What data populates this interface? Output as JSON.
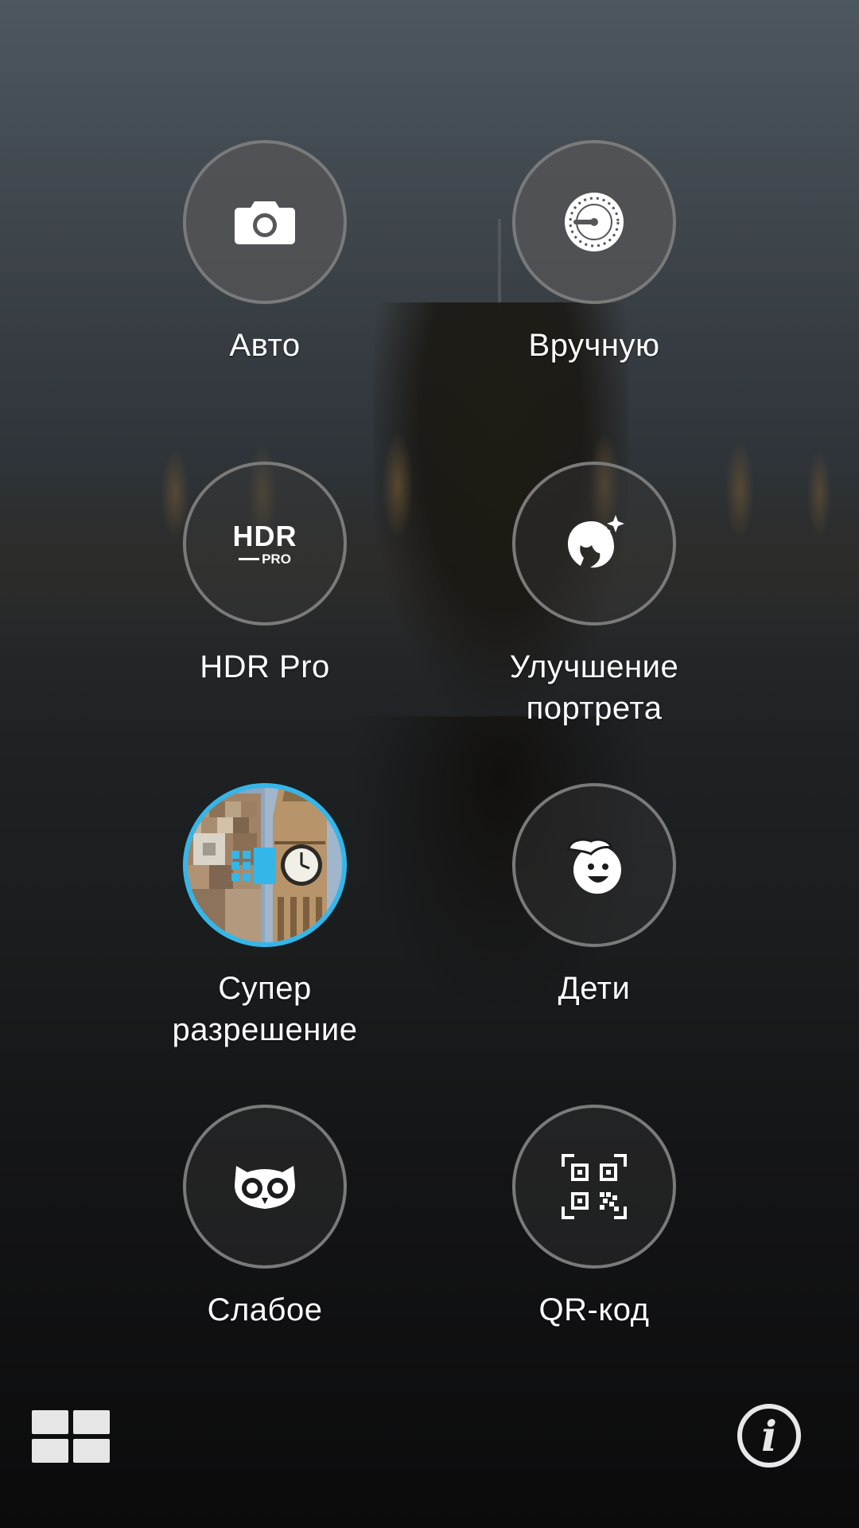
{
  "modes": [
    {
      "id": "auto",
      "label": "Авто",
      "icon": "camera-icon",
      "selected": false
    },
    {
      "id": "manual",
      "label": "Вручную",
      "icon": "manual-dial-icon",
      "selected": false
    },
    {
      "id": "hdr",
      "label": "HDR Pro",
      "icon": "hdr-pro-icon",
      "icon_text": "HDR",
      "icon_subtext": "PRO",
      "selected": false
    },
    {
      "id": "portrait",
      "label": "Улучшение\nпортрета",
      "icon": "portrait-enhance-icon",
      "selected": false
    },
    {
      "id": "super",
      "label": "Супер\nразрешение",
      "icon": "super-resolution-thumbnail",
      "selected": true
    },
    {
      "id": "kids",
      "label": "Дети",
      "icon": "kid-face-icon",
      "selected": false
    },
    {
      "id": "low",
      "label": "Слабое",
      "icon": "owl-icon",
      "selected": false
    },
    {
      "id": "qr",
      "label": "QR-код",
      "icon": "qr-code-icon",
      "selected": false
    }
  ],
  "bottom_bar": {
    "left_icon": "grid-view-icon",
    "right_icon": "info-icon",
    "info_glyph": "i"
  },
  "colors": {
    "selected_ring": "#35b6e8",
    "ring": "#7a7a7a"
  }
}
